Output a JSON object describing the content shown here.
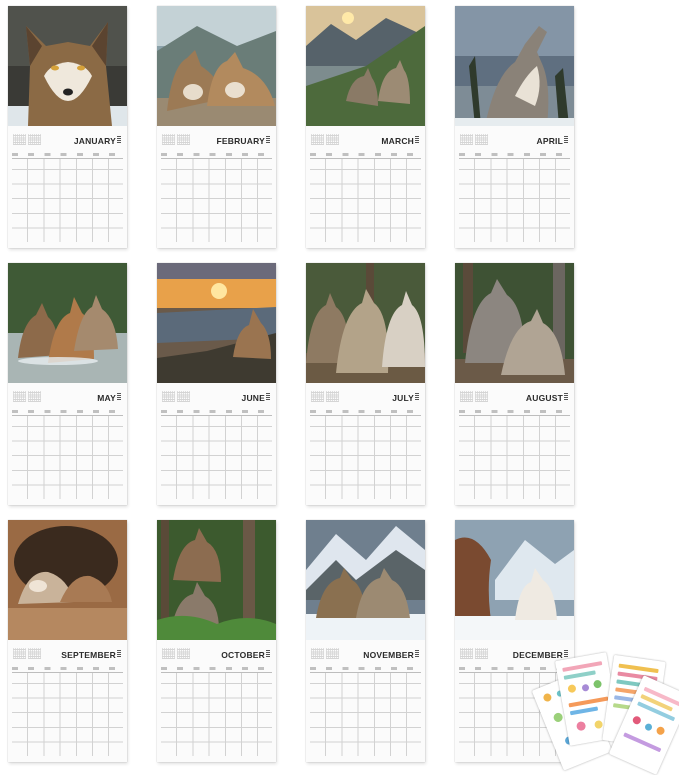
{
  "calendar": {
    "months": [
      {
        "name": "JANUARY"
      },
      {
        "name": "FEBRUARY"
      },
      {
        "name": "MARCH"
      },
      {
        "name": "APRIL"
      },
      {
        "name": "MAY"
      },
      {
        "name": "JUNE"
      },
      {
        "name": "JULY"
      },
      {
        "name": "AUGUST"
      },
      {
        "name": "SEPTEMBER"
      },
      {
        "name": "OCTOBER"
      },
      {
        "name": "NOVEMBER"
      },
      {
        "name": "DECEMBER"
      }
    ]
  },
  "colors": {
    "background": "#ffffff",
    "sheet": "#fbfbfb",
    "grid_line": "#d2d2d2",
    "month_text": "#2b2b2b"
  },
  "photos": [
    {
      "subject": "wolf-portrait-icon"
    },
    {
      "subject": "two-wolves-resting-icon"
    },
    {
      "subject": "wolves-mountain-sunrise-icon"
    },
    {
      "subject": "howling-wolf-icon"
    },
    {
      "subject": "wolves-in-stream-icon"
    },
    {
      "subject": "wolf-on-rock-sunset-icon"
    },
    {
      "subject": "wolf-pack-forest-icon"
    },
    {
      "subject": "wolf-pair-forest-icon"
    },
    {
      "subject": "wolves-in-den-icon"
    },
    {
      "subject": "wolves-ferns-icon"
    },
    {
      "subject": "wolves-snow-mountain-icon"
    },
    {
      "subject": "white-wolf-snow-icon"
    }
  ]
}
